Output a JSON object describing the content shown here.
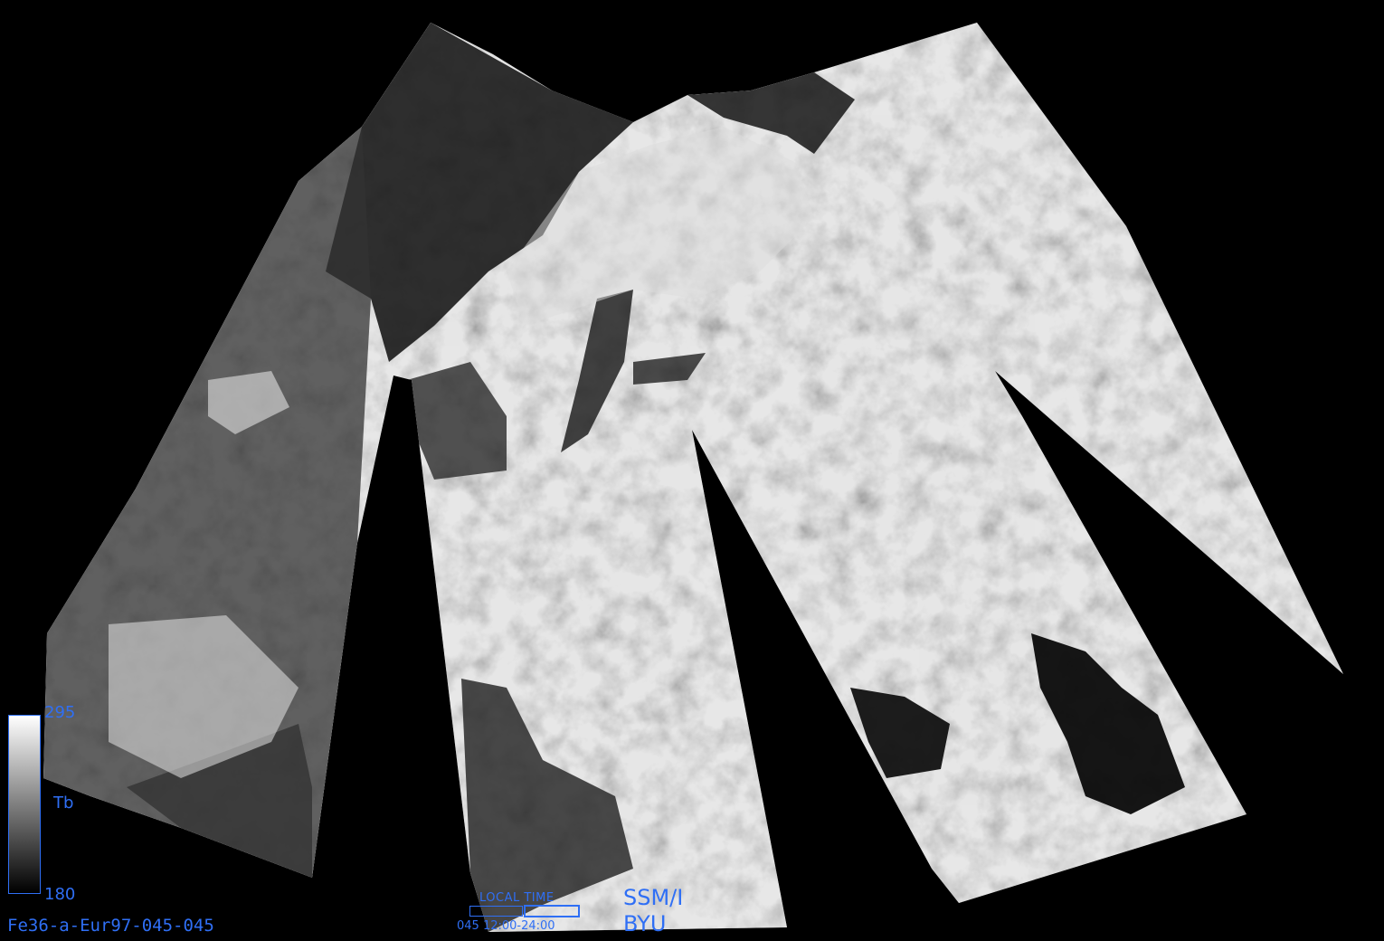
{
  "map": {
    "sensor": "SSM/I",
    "organization": "BYU",
    "file_id": "Fe36-a-Eur97-045-045",
    "colorbar": {
      "variable": "Tb",
      "max": "295",
      "min": "180",
      "gradient": [
        "#ffffff",
        "#000000"
      ]
    },
    "local_time": {
      "label": "LOCAL  TIME",
      "value": "045  12:00-24:00"
    }
  }
}
